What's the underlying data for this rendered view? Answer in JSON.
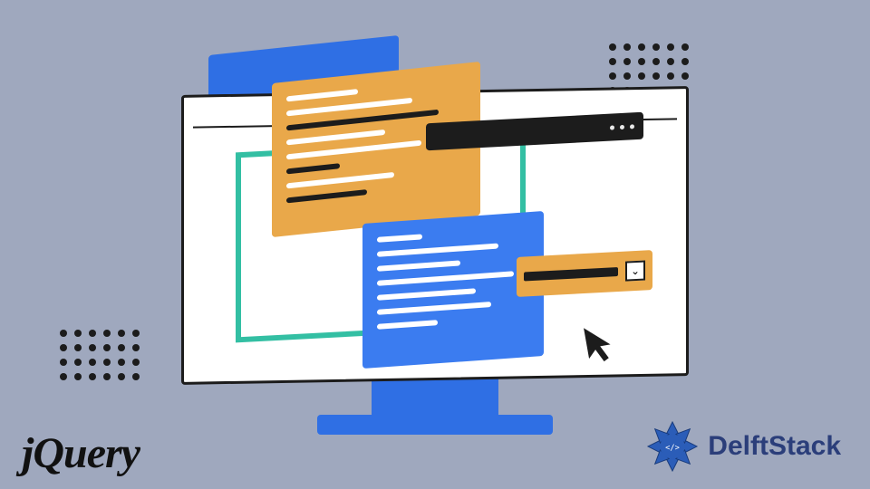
{
  "logos": {
    "jquery_text": "jQuery",
    "delft_text": "DelftStack",
    "delft_badge": "</>"
  },
  "illustration": {
    "selectbox_chevron": "⌄"
  }
}
